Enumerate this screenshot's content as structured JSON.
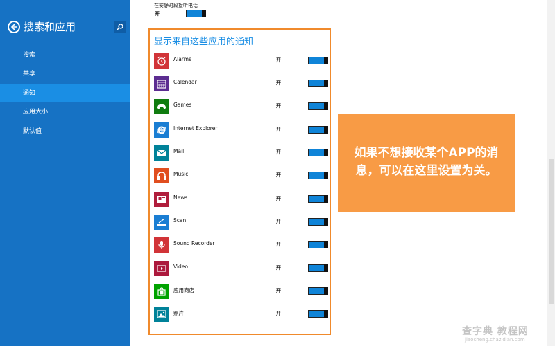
{
  "sidebar": {
    "title": "搜索和应用",
    "items": [
      {
        "label": "搜索",
        "active": false
      },
      {
        "label": "共享",
        "active": false
      },
      {
        "label": "通知",
        "active": true
      },
      {
        "label": "应用大小",
        "active": false
      },
      {
        "label": "默认值",
        "active": false
      }
    ]
  },
  "top_setting": {
    "label": "在安静时段接听电话",
    "state": "开",
    "on": true
  },
  "section": {
    "title": "显示来自这些应用的通知"
  },
  "apps": [
    {
      "name": "Alarms",
      "state": "开",
      "on": true,
      "icon": "alarm-clock-icon",
      "color": "#d13438"
    },
    {
      "name": "Calendar",
      "state": "开",
      "on": true,
      "icon": "calendar-icon",
      "color": "#5c2d91"
    },
    {
      "name": "Games",
      "state": "开",
      "on": true,
      "icon": "gamepad-icon",
      "color": "#107c10"
    },
    {
      "name": "Internet Explorer",
      "state": "开",
      "on": true,
      "icon": "ie-icon",
      "color": "#1a7ed3"
    },
    {
      "name": "Mail",
      "state": "开",
      "on": true,
      "icon": "mail-icon",
      "color": "#008299"
    },
    {
      "name": "Music",
      "state": "开",
      "on": true,
      "icon": "headphones-icon",
      "color": "#e04e1f"
    },
    {
      "name": "News",
      "state": "开",
      "on": true,
      "icon": "newspaper-icon",
      "color": "#b01e3c"
    },
    {
      "name": "Scan",
      "state": "开",
      "on": true,
      "icon": "scanner-icon",
      "color": "#1a7ed3"
    },
    {
      "name": "Sound Recorder",
      "state": "开",
      "on": true,
      "icon": "microphone-icon",
      "color": "#d13438"
    },
    {
      "name": "Video",
      "state": "开",
      "on": true,
      "icon": "video-icon",
      "color": "#ac193d"
    },
    {
      "name": "应用商店",
      "state": "开",
      "on": true,
      "icon": "store-icon",
      "color": "#00a300"
    },
    {
      "name": "照片",
      "state": "开",
      "on": true,
      "icon": "photo-icon",
      "color": "#008299"
    }
  ],
  "callout": {
    "text": "如果不想接收某个APP的消息，可以在这里设置为关。"
  },
  "watermark": {
    "main": "查字典 教程网",
    "sub": "jiaocheng.chazidian.com"
  }
}
